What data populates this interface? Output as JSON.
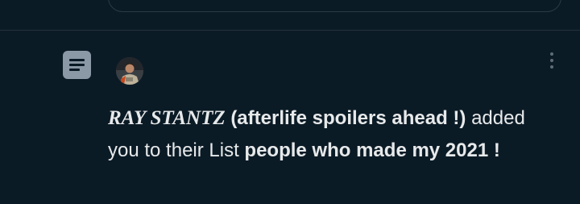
{
  "notification": {
    "user_display_name": "RAY STANTZ",
    "user_name_suffix": "(afterlife spoilers ahead !)",
    "action_text": "added you to their List",
    "list_name": "people who made my 2021 !"
  },
  "icons": {
    "notification_type": "list-icon",
    "menu": "more-vertical-icon"
  },
  "colors": {
    "background": "#0b1b26",
    "text": "#e7e9ea",
    "icon": "#8b98a5",
    "divider": "#22313b"
  }
}
